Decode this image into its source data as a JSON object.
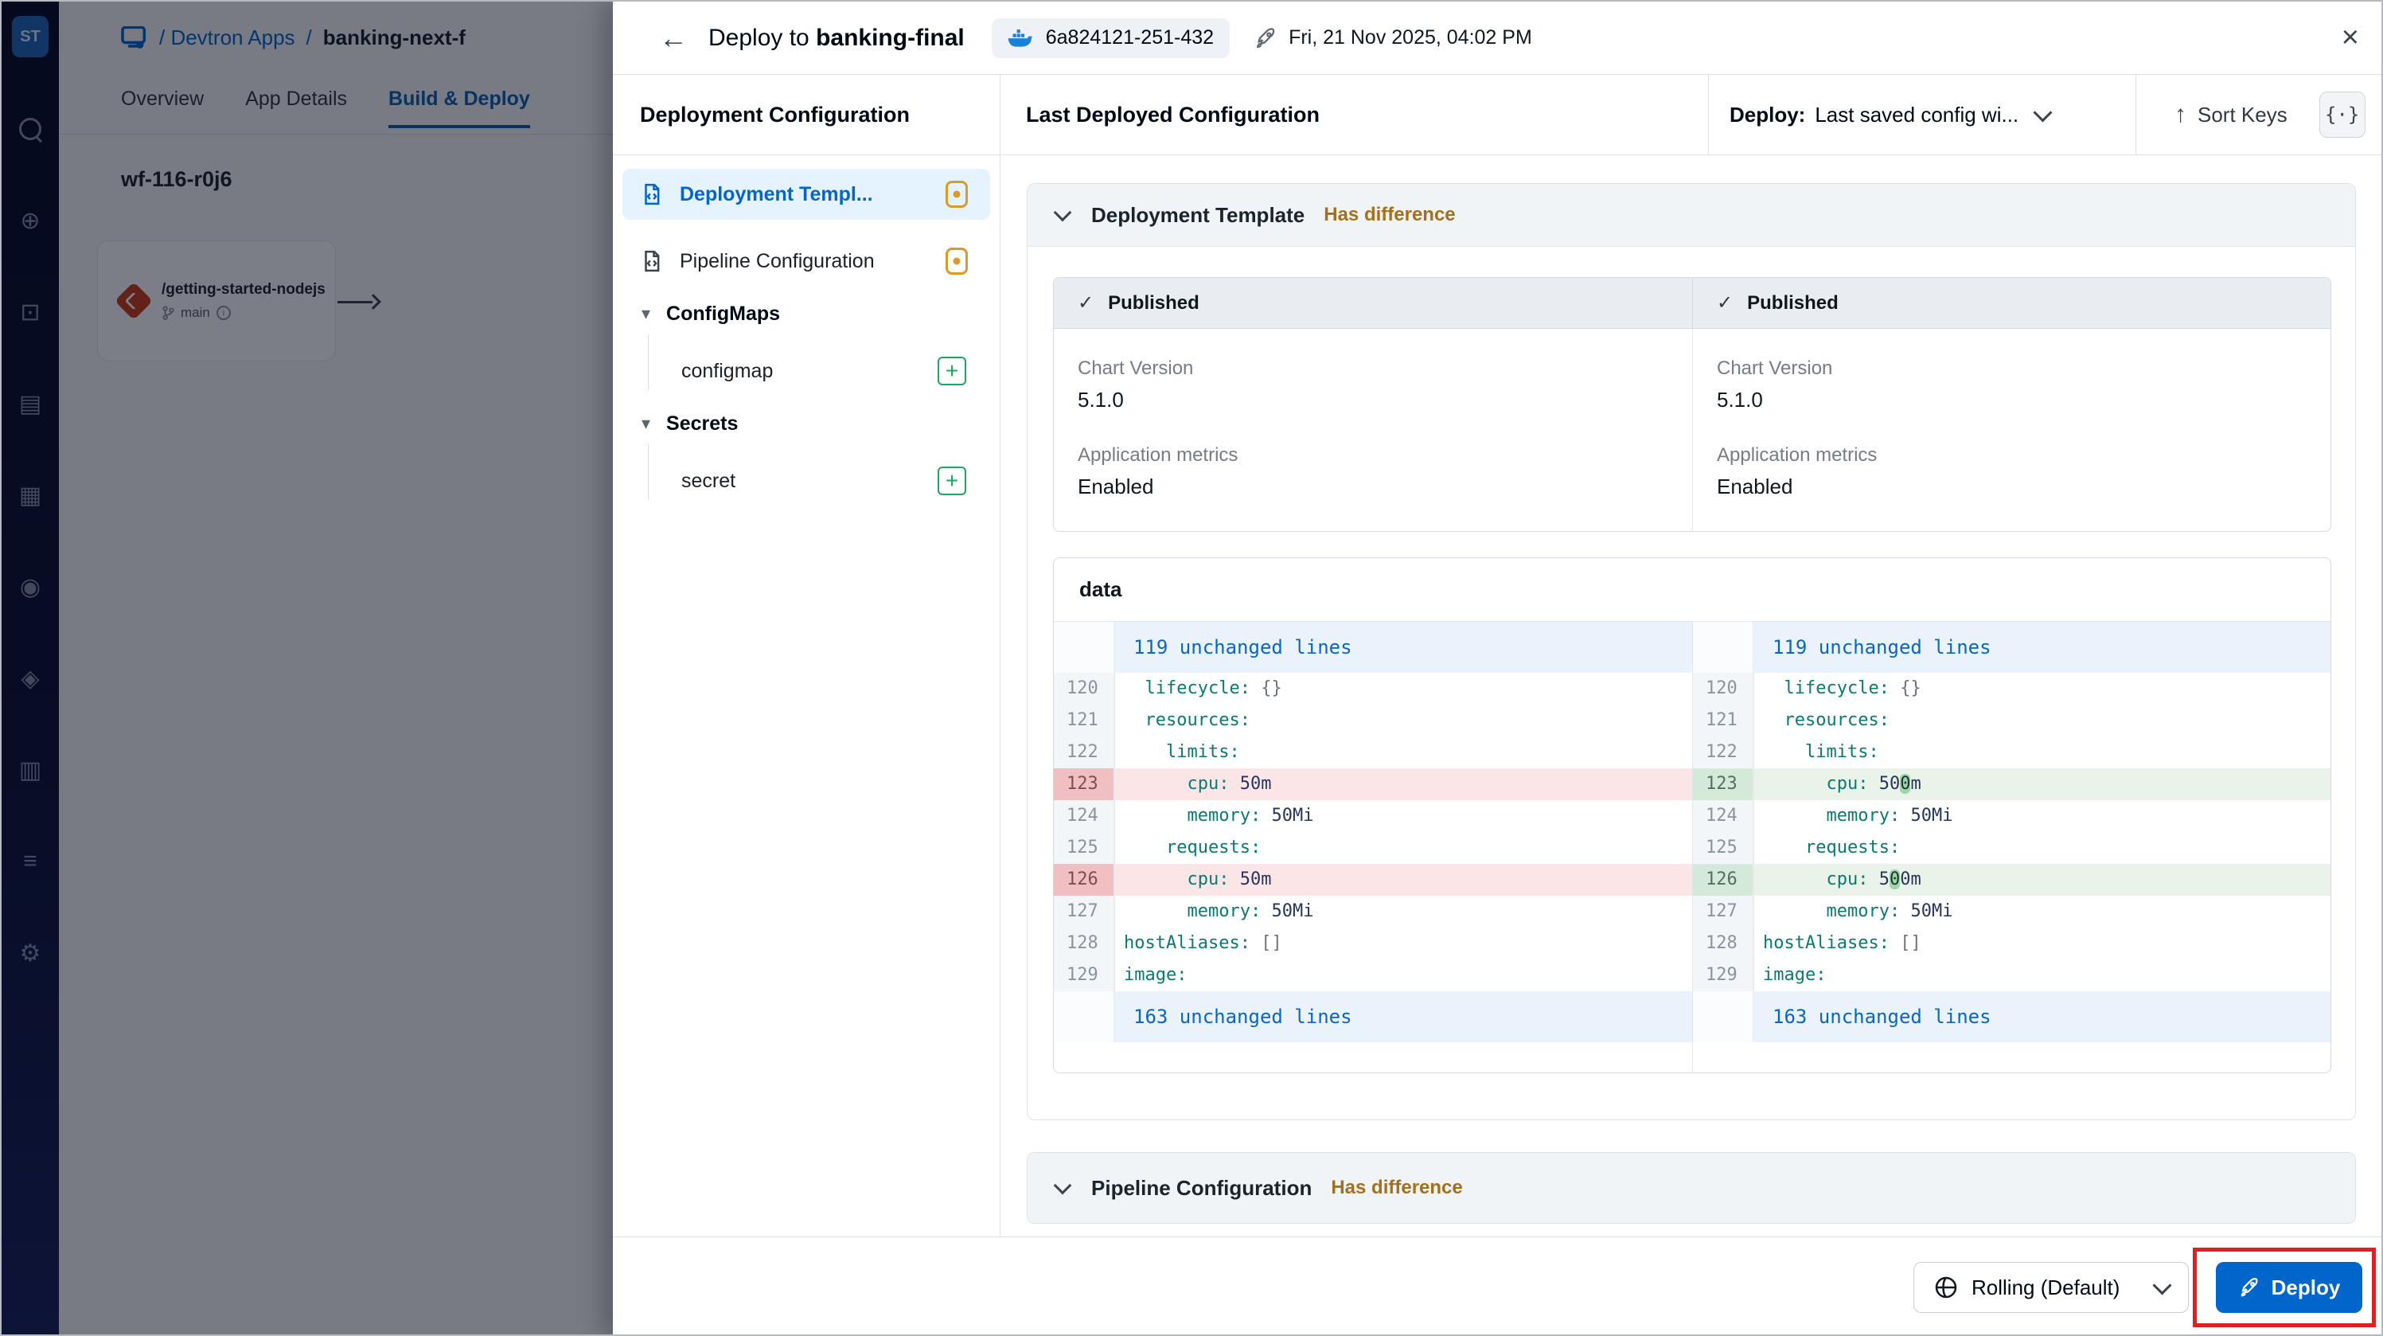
{
  "colors": {
    "accent_blue": "#0066cc",
    "warning_text": "#a5701d",
    "added_green": "#1da861",
    "modified_amber": "#da9b27",
    "removed_row_bg": "#fbe5e6",
    "added_row_bg": "#e9f3ea",
    "annotation_red": "#e02020",
    "sidebar_bg": "#0a1133"
  },
  "background": {
    "sidebar": {
      "logo_text": "ST",
      "icons": [
        "search-icon",
        "global-config-icon",
        "devtron-apps-icon",
        "applications-icon",
        "charts-icon",
        "resource-browser-icon",
        "security-icon",
        "monitoring-icon",
        "stacks-icon",
        "settings-icon"
      ]
    },
    "breadcrumb": {
      "root": "/ Devtron Apps",
      "separator": " / ",
      "current": "banking-next-f"
    },
    "tabs": [
      {
        "label": "Overview",
        "active": false
      },
      {
        "label": "App Details",
        "active": false
      },
      {
        "label": "Build & Deploy",
        "active": true
      }
    ],
    "workflow_title": "wf-116-r0j6",
    "node_card": {
      "title": "/getting-started-nodejs",
      "branch": "main",
      "info_icon": "i"
    }
  },
  "drawer": {
    "header": {
      "back_icon": "←",
      "title_prefix": "Deploy to ",
      "app_name": "banking-final",
      "image_tag": "6a824121-251-432",
      "deployed_at": "Fri, 21 Nov 2025, 04:02 PM",
      "close_icon": "×"
    },
    "subheader": {
      "left_title": "Deployment Configuration",
      "middle_title": "Last Deployed Configuration",
      "deploy_select_label": "Deploy:",
      "deploy_select_value": "Last saved config wi...",
      "sort_keys_label": "Sort Keys",
      "sort_icon": "↑",
      "code_toggle_icon": "{·}"
    },
    "nav": {
      "items": [
        {
          "label": "Deployment Templ...",
          "selected": true,
          "badge": "modified"
        },
        {
          "label": "Pipeline Configuration",
          "selected": false,
          "badge": "modified"
        }
      ],
      "groups": [
        {
          "label": "ConfigMaps",
          "caret": "▾",
          "children": [
            {
              "label": "configmap",
              "badge": "add"
            }
          ]
        },
        {
          "label": "Secrets",
          "caret": "▾",
          "children": [
            {
              "label": "secret",
              "badge": "add"
            }
          ]
        }
      ]
    },
    "sections": [
      {
        "title": "Deployment Template",
        "status": "Has difference"
      },
      {
        "title": "Pipeline Configuration",
        "status": "Has difference"
      }
    ],
    "published": {
      "columns": [
        {
          "status": "Published",
          "check": "✓",
          "fields": [
            {
              "label": "Chart Version",
              "value": "5.1.0"
            },
            {
              "label": "Application metrics",
              "value": "Enabled"
            }
          ]
        },
        {
          "status": "Published",
          "check": "✓",
          "fields": [
            {
              "label": "Chart Version",
              "value": "5.1.0"
            },
            {
              "label": "Application metrics",
              "value": "Enabled"
            }
          ]
        }
      ]
    },
    "data_block": {
      "title": "data",
      "top_band": "119 unchanged lines",
      "bottom_band": "163 unchanged lines",
      "left_lines": [
        {
          "num": "120",
          "state": "",
          "segs": [
            {
              "c": "sp",
              "s": "  "
            },
            {
              "c": "k",
              "s": "lifecycle:"
            },
            {
              "c": "sp",
              "s": " "
            },
            {
              "c": "b",
              "s": "{}"
            }
          ]
        },
        {
          "num": "121",
          "state": "",
          "segs": [
            {
              "c": "sp",
              "s": "  "
            },
            {
              "c": "k",
              "s": "resources:"
            }
          ]
        },
        {
          "num": "122",
          "state": "",
          "segs": [
            {
              "c": "sp",
              "s": "    "
            },
            {
              "c": "k",
              "s": "limits:"
            }
          ]
        },
        {
          "num": "123",
          "state": "del",
          "segs": [
            {
              "c": "sp",
              "s": "      "
            },
            {
              "c": "k",
              "s": "cpu:"
            },
            {
              "c": "sp",
              "s": " "
            },
            {
              "c": "v",
              "s": "50m"
            }
          ]
        },
        {
          "num": "124",
          "state": "",
          "segs": [
            {
              "c": "sp",
              "s": "      "
            },
            {
              "c": "k",
              "s": "memory:"
            },
            {
              "c": "sp",
              "s": " "
            },
            {
              "c": "v",
              "s": "50Mi"
            }
          ]
        },
        {
          "num": "125",
          "state": "",
          "segs": [
            {
              "c": "sp",
              "s": "    "
            },
            {
              "c": "k",
              "s": "requests:"
            }
          ]
        },
        {
          "num": "126",
          "state": "del",
          "segs": [
            {
              "c": "sp",
              "s": "      "
            },
            {
              "c": "k",
              "s": "cpu:"
            },
            {
              "c": "sp",
              "s": " "
            },
            {
              "c": "v",
              "s": "50m"
            }
          ]
        },
        {
          "num": "127",
          "state": "",
          "segs": [
            {
              "c": "sp",
              "s": "      "
            },
            {
              "c": "k",
              "s": "memory:"
            },
            {
              "c": "sp",
              "s": " "
            },
            {
              "c": "v",
              "s": "50Mi"
            }
          ]
        },
        {
          "num": "128",
          "state": "",
          "segs": [
            {
              "c": "k",
              "s": "hostAliases:"
            },
            {
              "c": "sp",
              "s": " "
            },
            {
              "c": "b",
              "s": "[]"
            }
          ]
        },
        {
          "num": "129",
          "state": "",
          "segs": [
            {
              "c": "k",
              "s": "image:"
            }
          ]
        }
      ],
      "right_lines": [
        {
          "num": "120",
          "state": "",
          "segs": [
            {
              "c": "sp",
              "s": "  "
            },
            {
              "c": "k",
              "s": "lifecycle:"
            },
            {
              "c": "sp",
              "s": " "
            },
            {
              "c": "b",
              "s": "{}"
            }
          ]
        },
        {
          "num": "121",
          "state": "",
          "segs": [
            {
              "c": "sp",
              "s": "  "
            },
            {
              "c": "k",
              "s": "resources:"
            }
          ]
        },
        {
          "num": "122",
          "state": "",
          "segs": [
            {
              "c": "sp",
              "s": "    "
            },
            {
              "c": "k",
              "s": "limits:"
            }
          ]
        },
        {
          "num": "123",
          "state": "add",
          "segs": [
            {
              "c": "sp",
              "s": "      "
            },
            {
              "c": "k",
              "s": "cpu:"
            },
            {
              "c": "sp",
              "s": " "
            },
            {
              "c": "v",
              "s": "50"
            },
            {
              "c": "hl",
              "s": "0"
            },
            {
              "c": "v",
              "s": "m"
            }
          ]
        },
        {
          "num": "124",
          "state": "",
          "segs": [
            {
              "c": "sp",
              "s": "      "
            },
            {
              "c": "k",
              "s": "memory:"
            },
            {
              "c": "sp",
              "s": " "
            },
            {
              "c": "v",
              "s": "50Mi"
            }
          ]
        },
        {
          "num": "125",
          "state": "",
          "segs": [
            {
              "c": "sp",
              "s": "    "
            },
            {
              "c": "k",
              "s": "requests:"
            }
          ]
        },
        {
          "num": "126",
          "state": "add",
          "segs": [
            {
              "c": "sp",
              "s": "      "
            },
            {
              "c": "k",
              "s": "cpu:"
            },
            {
              "c": "sp",
              "s": " "
            },
            {
              "c": "v",
              "s": "5"
            },
            {
              "c": "hl",
              "s": "0"
            },
            {
              "c": "v",
              "s": "0m"
            }
          ]
        },
        {
          "num": "127",
          "state": "",
          "segs": [
            {
              "c": "sp",
              "s": "      "
            },
            {
              "c": "k",
              "s": "memory:"
            },
            {
              "c": "sp",
              "s": " "
            },
            {
              "c": "v",
              "s": "50Mi"
            }
          ]
        },
        {
          "num": "128",
          "state": "",
          "segs": [
            {
              "c": "k",
              "s": "hostAliases:"
            },
            {
              "c": "sp",
              "s": " "
            },
            {
              "c": "b",
              "s": "[]"
            }
          ]
        },
        {
          "num": "129",
          "state": "",
          "segs": [
            {
              "c": "k",
              "s": "image:"
            }
          ]
        }
      ]
    },
    "footer": {
      "strategy_label": "Rolling (Default)",
      "deploy_label": "Deploy"
    }
  }
}
